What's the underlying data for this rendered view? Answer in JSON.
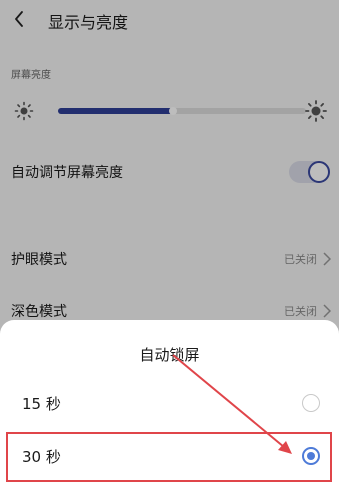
{
  "header": {
    "title": "显示与亮度"
  },
  "brightness": {
    "section_label": "屏幕亮度",
    "level": 0.47
  },
  "auto_brightness": {
    "label": "自动调节屏幕亮度",
    "enabled": true
  },
  "eye_protection": {
    "label": "护眼模式",
    "value": "已关闭"
  },
  "dark_mode": {
    "label": "深色模式",
    "value": "已关闭"
  },
  "auto_lock_sheet": {
    "title": "自动锁屏",
    "options": [
      {
        "label": "15 秒",
        "selected": false
      },
      {
        "label": "30 秒",
        "selected": true
      }
    ]
  },
  "colors": {
    "accent": "#2f3f96",
    "radio_selected": "#4e7bd8",
    "annotation_red": "#e0454a"
  },
  "icons": [
    "back-arrow",
    "sun-small",
    "sun-large",
    "chevron-right"
  ]
}
